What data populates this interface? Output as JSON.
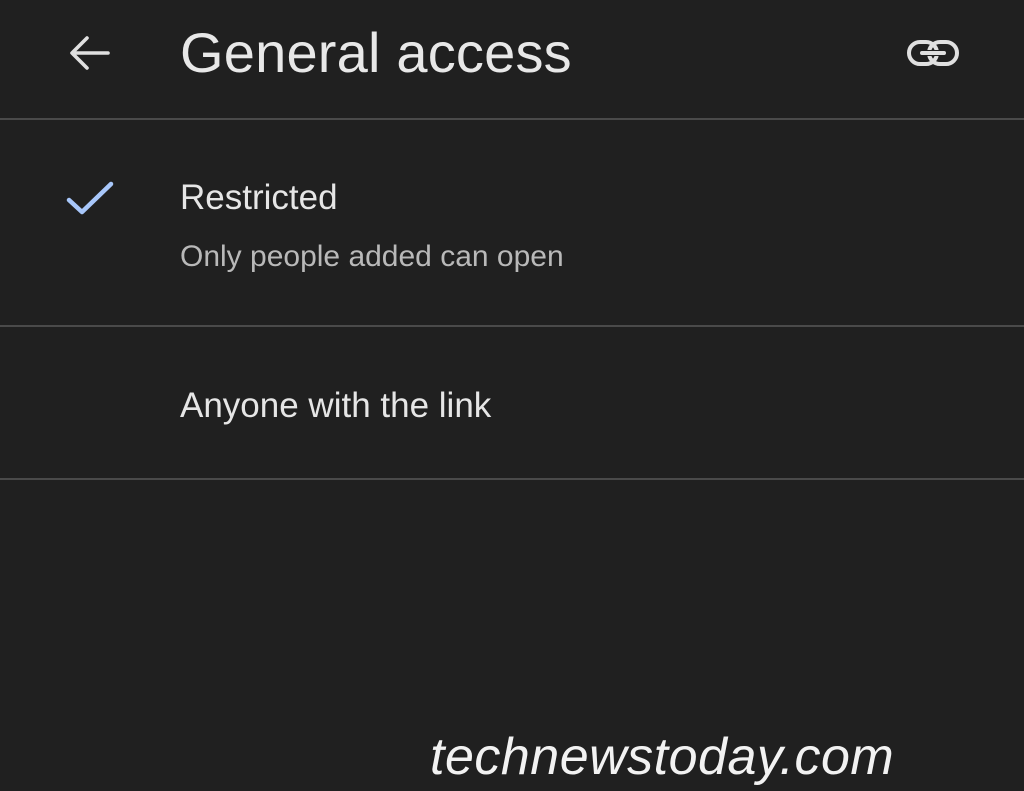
{
  "header": {
    "title": "General access",
    "back_icon": "arrow-left-icon",
    "link_icon": "link-icon"
  },
  "options": [
    {
      "label": "Restricted",
      "description": "Only people added can open",
      "selected": true,
      "icon": "check-icon"
    },
    {
      "label": "Anyone with the link",
      "selected": false
    }
  ],
  "watermark": "technewstoday.com",
  "colors": {
    "background": "#202020",
    "check_accent": "#a8c7fa",
    "divider": "#4a4a4a"
  }
}
